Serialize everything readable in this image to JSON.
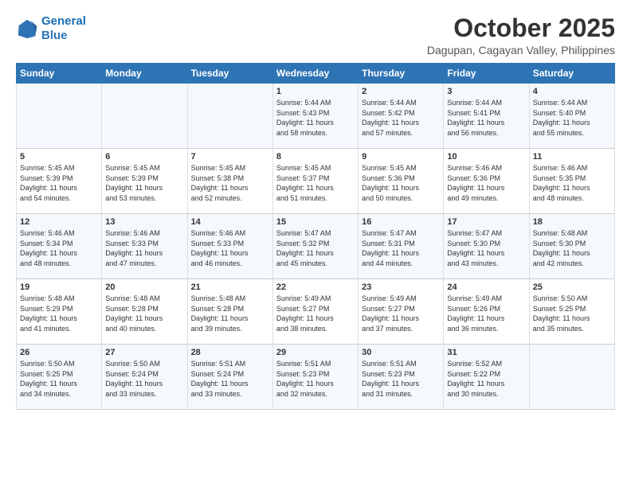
{
  "header": {
    "logo_line1": "General",
    "logo_line2": "Blue",
    "title": "October 2025",
    "subtitle": "Dagupan, Cagayan Valley, Philippines"
  },
  "weekdays": [
    "Sunday",
    "Monday",
    "Tuesday",
    "Wednesday",
    "Thursday",
    "Friday",
    "Saturday"
  ],
  "weeks": [
    [
      {
        "day": "",
        "info": ""
      },
      {
        "day": "",
        "info": ""
      },
      {
        "day": "",
        "info": ""
      },
      {
        "day": "1",
        "info": "Sunrise: 5:44 AM\nSunset: 5:43 PM\nDaylight: 11 hours\nand 58 minutes."
      },
      {
        "day": "2",
        "info": "Sunrise: 5:44 AM\nSunset: 5:42 PM\nDaylight: 11 hours\nand 57 minutes."
      },
      {
        "day": "3",
        "info": "Sunrise: 5:44 AM\nSunset: 5:41 PM\nDaylight: 11 hours\nand 56 minutes."
      },
      {
        "day": "4",
        "info": "Sunrise: 5:44 AM\nSunset: 5:40 PM\nDaylight: 11 hours\nand 55 minutes."
      }
    ],
    [
      {
        "day": "5",
        "info": "Sunrise: 5:45 AM\nSunset: 5:39 PM\nDaylight: 11 hours\nand 54 minutes."
      },
      {
        "day": "6",
        "info": "Sunrise: 5:45 AM\nSunset: 5:39 PM\nDaylight: 11 hours\nand 53 minutes."
      },
      {
        "day": "7",
        "info": "Sunrise: 5:45 AM\nSunset: 5:38 PM\nDaylight: 11 hours\nand 52 minutes."
      },
      {
        "day": "8",
        "info": "Sunrise: 5:45 AM\nSunset: 5:37 PM\nDaylight: 11 hours\nand 51 minutes."
      },
      {
        "day": "9",
        "info": "Sunrise: 5:45 AM\nSunset: 5:36 PM\nDaylight: 11 hours\nand 50 minutes."
      },
      {
        "day": "10",
        "info": "Sunrise: 5:46 AM\nSunset: 5:36 PM\nDaylight: 11 hours\nand 49 minutes."
      },
      {
        "day": "11",
        "info": "Sunrise: 5:46 AM\nSunset: 5:35 PM\nDaylight: 11 hours\nand 48 minutes."
      }
    ],
    [
      {
        "day": "12",
        "info": "Sunrise: 5:46 AM\nSunset: 5:34 PM\nDaylight: 11 hours\nand 48 minutes."
      },
      {
        "day": "13",
        "info": "Sunrise: 5:46 AM\nSunset: 5:33 PM\nDaylight: 11 hours\nand 47 minutes."
      },
      {
        "day": "14",
        "info": "Sunrise: 5:46 AM\nSunset: 5:33 PM\nDaylight: 11 hours\nand 46 minutes."
      },
      {
        "day": "15",
        "info": "Sunrise: 5:47 AM\nSunset: 5:32 PM\nDaylight: 11 hours\nand 45 minutes."
      },
      {
        "day": "16",
        "info": "Sunrise: 5:47 AM\nSunset: 5:31 PM\nDaylight: 11 hours\nand 44 minutes."
      },
      {
        "day": "17",
        "info": "Sunrise: 5:47 AM\nSunset: 5:30 PM\nDaylight: 11 hours\nand 43 minutes."
      },
      {
        "day": "18",
        "info": "Sunrise: 5:48 AM\nSunset: 5:30 PM\nDaylight: 11 hours\nand 42 minutes."
      }
    ],
    [
      {
        "day": "19",
        "info": "Sunrise: 5:48 AM\nSunset: 5:29 PM\nDaylight: 11 hours\nand 41 minutes."
      },
      {
        "day": "20",
        "info": "Sunrise: 5:48 AM\nSunset: 5:28 PM\nDaylight: 11 hours\nand 40 minutes."
      },
      {
        "day": "21",
        "info": "Sunrise: 5:48 AM\nSunset: 5:28 PM\nDaylight: 11 hours\nand 39 minutes."
      },
      {
        "day": "22",
        "info": "Sunrise: 5:49 AM\nSunset: 5:27 PM\nDaylight: 11 hours\nand 38 minutes."
      },
      {
        "day": "23",
        "info": "Sunrise: 5:49 AM\nSunset: 5:27 PM\nDaylight: 11 hours\nand 37 minutes."
      },
      {
        "day": "24",
        "info": "Sunrise: 5:49 AM\nSunset: 5:26 PM\nDaylight: 11 hours\nand 36 minutes."
      },
      {
        "day": "25",
        "info": "Sunrise: 5:50 AM\nSunset: 5:25 PM\nDaylight: 11 hours\nand 35 minutes."
      }
    ],
    [
      {
        "day": "26",
        "info": "Sunrise: 5:50 AM\nSunset: 5:25 PM\nDaylight: 11 hours\nand 34 minutes."
      },
      {
        "day": "27",
        "info": "Sunrise: 5:50 AM\nSunset: 5:24 PM\nDaylight: 11 hours\nand 33 minutes."
      },
      {
        "day": "28",
        "info": "Sunrise: 5:51 AM\nSunset: 5:24 PM\nDaylight: 11 hours\nand 33 minutes."
      },
      {
        "day": "29",
        "info": "Sunrise: 5:51 AM\nSunset: 5:23 PM\nDaylight: 11 hours\nand 32 minutes."
      },
      {
        "day": "30",
        "info": "Sunrise: 5:51 AM\nSunset: 5:23 PM\nDaylight: 11 hours\nand 31 minutes."
      },
      {
        "day": "31",
        "info": "Sunrise: 5:52 AM\nSunset: 5:22 PM\nDaylight: 11 hours\nand 30 minutes."
      },
      {
        "day": "",
        "info": ""
      }
    ]
  ]
}
